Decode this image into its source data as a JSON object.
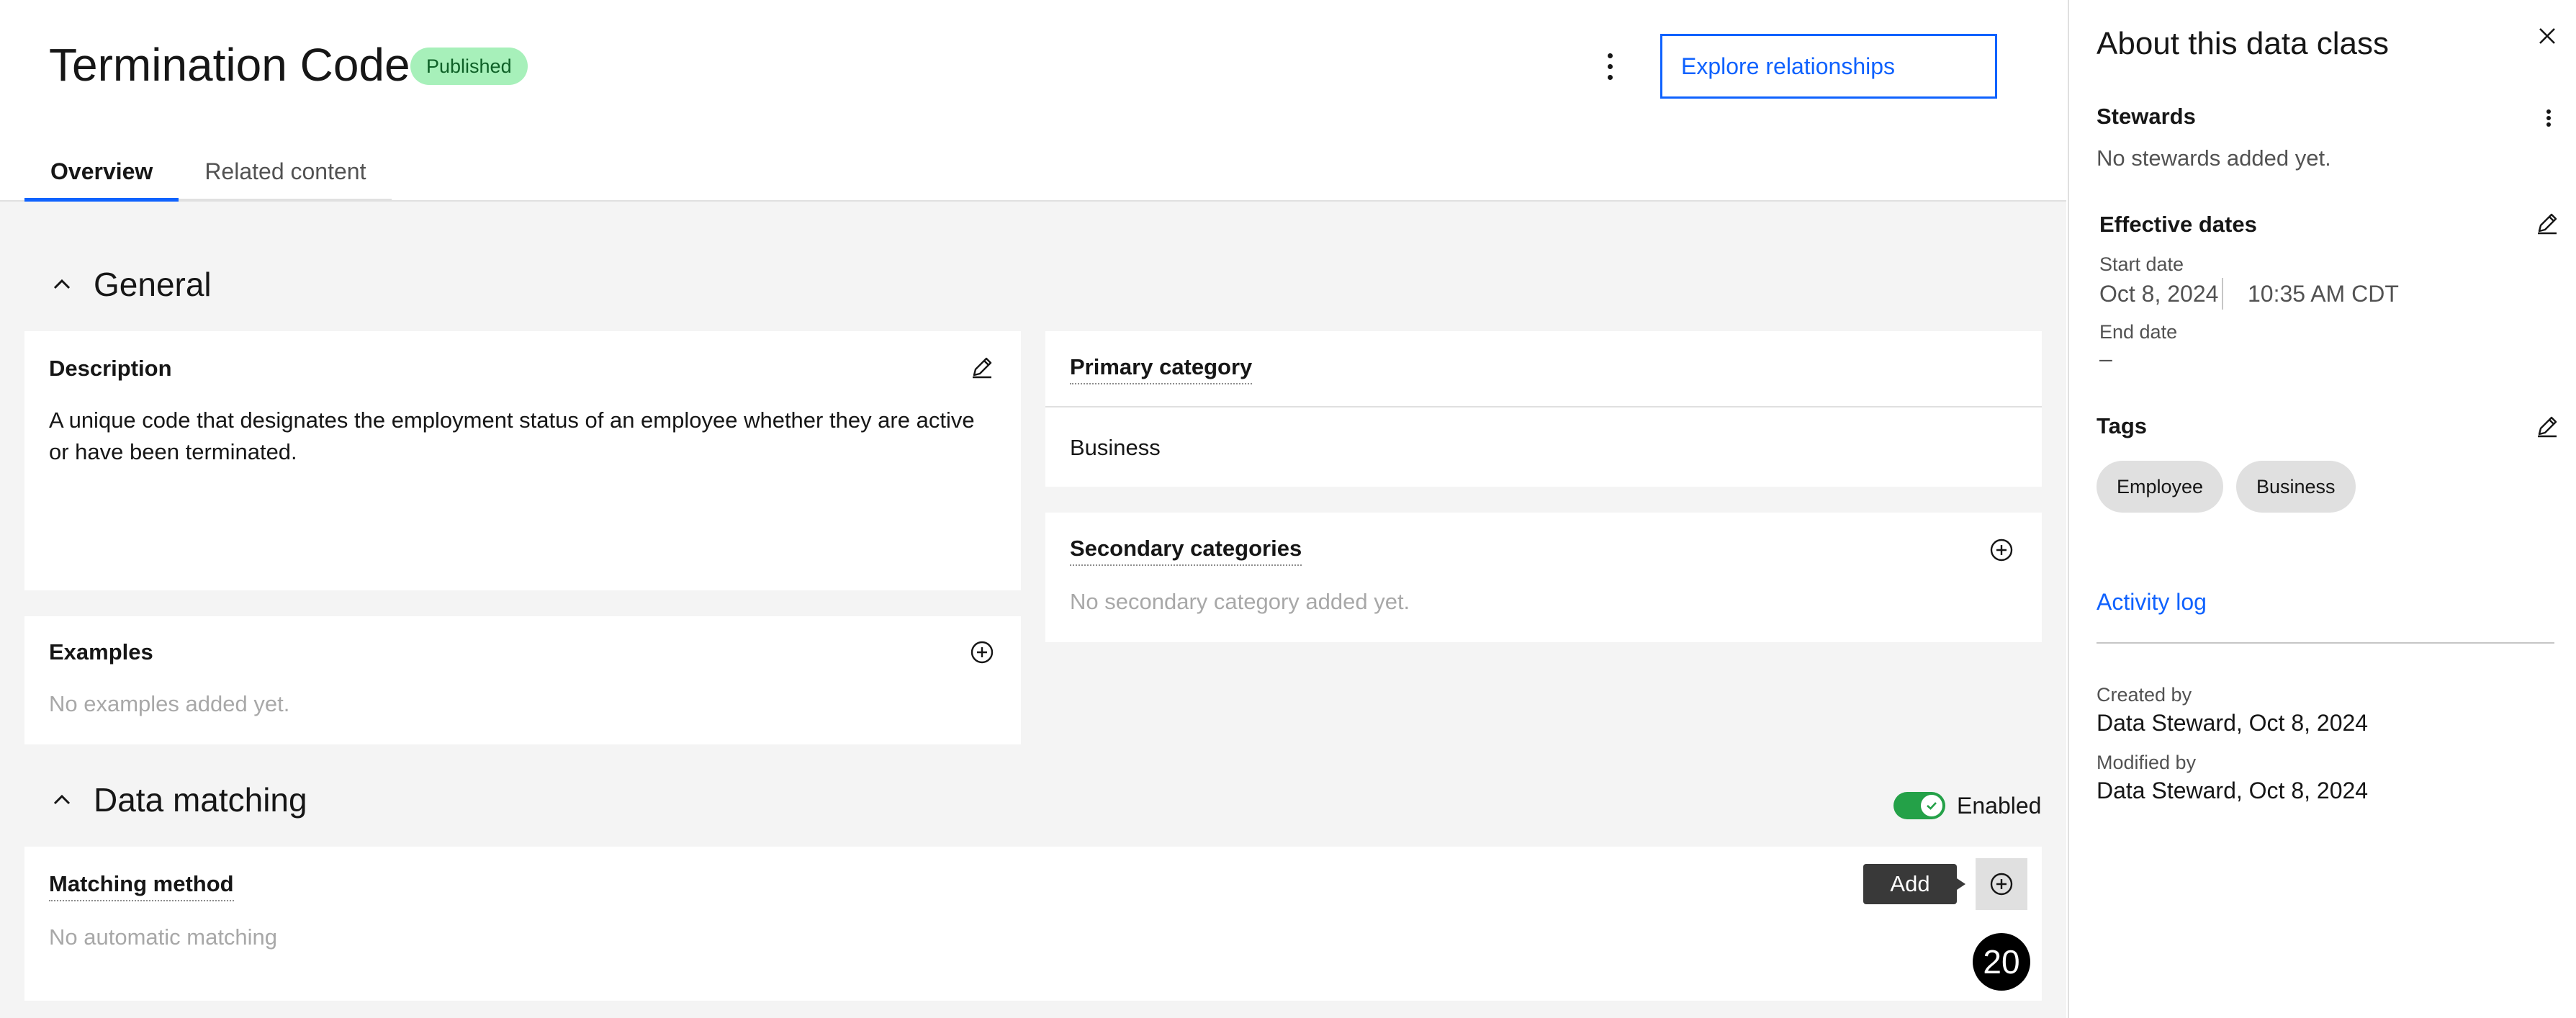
{
  "header": {
    "title": "Termination Code",
    "status": "Published",
    "explore_label": "Explore relationships",
    "tabs": [
      {
        "label": "Overview",
        "active": true
      },
      {
        "label": "Related content",
        "active": false
      }
    ]
  },
  "general": {
    "heading": "General",
    "description": {
      "title": "Description",
      "text": "A unique code that designates the employment status of an employee whether they are active or have been terminated."
    },
    "examples": {
      "title": "Examples",
      "empty": "No examples added yet."
    },
    "primary_category": {
      "title": "Primary category",
      "value": "Business"
    },
    "secondary_categories": {
      "title": "Secondary categories",
      "empty": "No secondary category added yet."
    }
  },
  "data_matching": {
    "heading": "Data matching",
    "toggle_label": "Enabled",
    "toggle_on": true,
    "matching_method": {
      "title": "Matching method",
      "value": "No automatic matching"
    },
    "tooltip": "Add",
    "badge": "20"
  },
  "side_panel": {
    "title": "About this data class",
    "stewards": {
      "title": "Stewards",
      "empty": "No stewards added yet."
    },
    "effective_dates": {
      "title": "Effective dates",
      "start_label": "Start date",
      "start_date": "Oct 8, 2024",
      "start_time": "10:35 AM CDT",
      "end_label": "End date",
      "end_value": "–"
    },
    "tags": {
      "title": "Tags",
      "items": [
        "Employee",
        "Business"
      ]
    },
    "activity_log": "Activity log",
    "created_label": "Created by",
    "created_value": "Data Steward, Oct 8, 2024",
    "modified_label": "Modified by",
    "modified_value": "Data Steward, Oct 8, 2024"
  },
  "colors": {
    "accent": "#0f62fe",
    "published_bg": "#a7f0ba",
    "toggle_on": "#24a148"
  }
}
